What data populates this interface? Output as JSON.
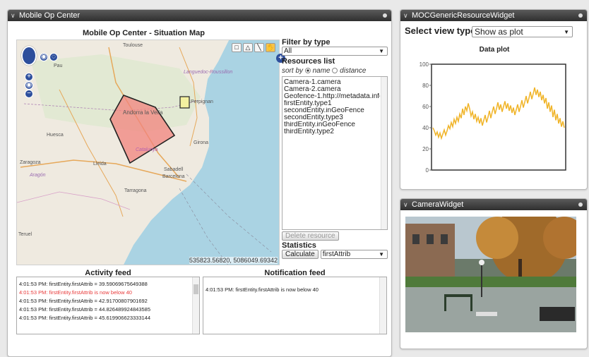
{
  "mobile_op": {
    "header": "Mobile Op Center",
    "map": {
      "title": "Mobile Op Center - Situation Map",
      "coords": "535823.56820, 5086049.69342",
      "labels": {
        "toulouse": "Toulouse",
        "pau": "Pau",
        "languedoc": "Languedoc-Roussillon",
        "perpignan": "Perpignan",
        "andorra": "Andorra la Vella",
        "huesca": "Huesca",
        "girona": "Girona",
        "catalunya": "Catalunya",
        "zaragoza": "Zaragoza",
        "lleida": "Lleida",
        "sabadell": "Sabadell",
        "aragon": "Aragón",
        "barcelona": "Barcelona",
        "tarragona": "Tarragona",
        "teruel": "Teruel"
      }
    },
    "filter": {
      "label": "Filter by type",
      "value": "All"
    },
    "resources": {
      "label": "Resources list",
      "sort_by": "sort by",
      "sort_name": "name",
      "sort_distance": "distance",
      "items": [
        "Camera-1.camera",
        "Camera-2.camera",
        "Geofence-1.http://metadata.info/o",
        "firstEntity.type1",
        "secondEntity.inGeoFence",
        "secondEntity.type3",
        "thirdEntity.inGeoFence",
        "thirdEntity.type2"
      ],
      "delete_button": "Delete resource"
    },
    "statistics": {
      "label": "Statistics",
      "calc_button": "Calculate",
      "attr_value": "firstAttrib"
    },
    "activity_feed": {
      "title": "Activity feed",
      "lines": [
        "4:01:53 PM: firstEntity.firstAttrib = 39.59069675649388",
        "4:01:53 PM: firstEntity.firstAttrib is now below 40",
        "4:01:53 PM: firstEntity.firstAttrib = 42.91700807901692",
        "4:01:53 PM: firstEntity.firstAttrib = 44.826489924843585",
        "4:01:53 PM: firstEntity.firstAttrib = 45.619906623333144"
      ]
    },
    "notification_feed": {
      "title": "Notification feed",
      "lines": [
        "4:01:53 PM: firstEntity.firstAttrib is now below 40"
      ]
    }
  },
  "resource_widget": {
    "header": "MOCGenericResourceWidget",
    "view_label": "Select view type",
    "view_value": "Show as plot"
  },
  "camera_widget": {
    "header": "CameraWidget"
  },
  "chart_data": {
    "type": "line",
    "title": "Data plot",
    "xlabel": "",
    "ylabel": "",
    "ylim": [
      0,
      100
    ],
    "yticks": [
      0,
      20,
      40,
      60,
      80,
      100
    ],
    "grid": false,
    "series": [
      {
        "color": "#f0b428",
        "values": [
          40,
          37,
          33,
          36,
          31,
          35,
          30,
          34,
          38,
          33,
          37,
          42,
          39,
          45,
          41,
          48,
          44,
          50,
          46,
          53,
          49,
          58,
          52,
          60,
          56,
          63,
          58,
          51,
          55,
          48,
          53,
          46,
          50,
          44,
          49,
          42,
          47,
          52,
          45,
          50,
          56,
          49,
          55,
          60,
          53,
          58,
          64,
          57,
          62,
          55,
          60,
          65,
          58,
          63,
          56,
          61,
          54,
          59,
          52,
          57,
          62,
          55,
          60,
          66,
          59,
          64,
          70,
          63,
          68,
          74,
          67,
          72,
          78,
          71,
          76,
          69,
          74,
          66,
          71,
          63,
          68,
          58,
          64,
          55,
          61,
          50,
          57,
          47,
          53,
          44,
          49,
          41,
          46,
          40
        ]
      }
    ]
  }
}
